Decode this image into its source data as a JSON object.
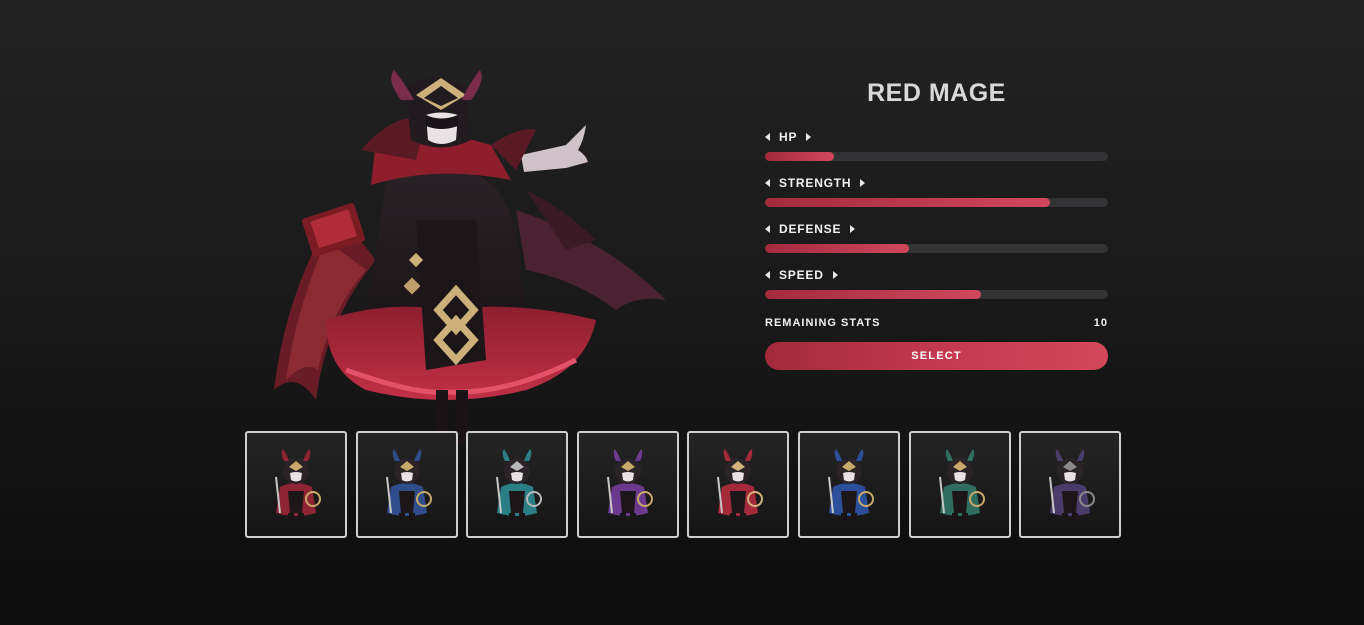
{
  "selected_class": {
    "name": "RED MAGE",
    "portrait_icon": "red-mage-portrait"
  },
  "stats": [
    {
      "label": "HP",
      "value_fraction": 0.2
    },
    {
      "label": "STRENGTH",
      "value_fraction": 0.83
    },
    {
      "label": "DEFENSE",
      "value_fraction": 0.42
    },
    {
      "label": "SPEED",
      "value_fraction": 0.63
    }
  ],
  "remaining": {
    "label": "REMAINING STATS",
    "value": "10"
  },
  "select_label": "SELECT",
  "colors": {
    "accent_start": "#a32a3c",
    "accent_end": "#d4475d",
    "track": "#333335",
    "slot_border": "#cfcfcf"
  },
  "roster": [
    {
      "icon": "knight-sword-shield-icon",
      "main": "#8e2434",
      "trim": "#c9a96a"
    },
    {
      "icon": "spear-knight-icon",
      "main": "#2f4d8a",
      "trim": "#c9a96a"
    },
    {
      "icon": "axe-warrior-icon",
      "main": "#2a7e86",
      "trim": "#b8b8b8"
    },
    {
      "icon": "archer-icon",
      "main": "#6b3a8e",
      "trim": "#c9a96a"
    },
    {
      "icon": "red-mage-icon",
      "main": "#a42a3a",
      "trim": "#d4b47a"
    },
    {
      "icon": "blue-mage-icon",
      "main": "#2c4f9c",
      "trim": "#c9a96a"
    },
    {
      "icon": "armored-axe-knight-icon",
      "main": "#2f6e5e",
      "trim": "#c9a96a"
    },
    {
      "icon": "rogue-icon",
      "main": "#4a3c6a",
      "trim": "#8a8a8a"
    }
  ]
}
